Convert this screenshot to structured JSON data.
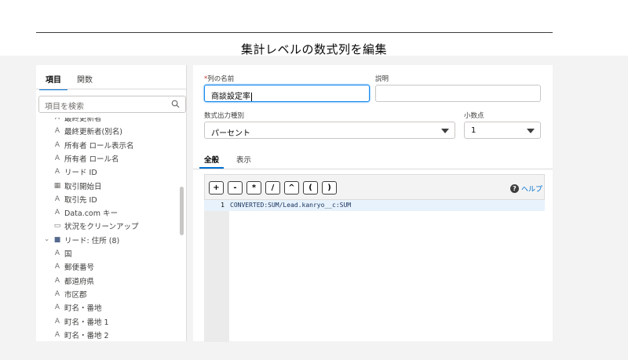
{
  "dialog": {
    "title": "集計レベルの数式列を編集"
  },
  "left_panel": {
    "tabs": [
      {
        "label": "項目"
      },
      {
        "label": "関数"
      }
    ],
    "search_placeholder": "項目を検索",
    "fields": [
      {
        "icon": "text-icon",
        "glyph": "A",
        "label": "最終更新者"
      },
      {
        "icon": "text-icon",
        "glyph": "A",
        "label": "最終更新者(別名)"
      },
      {
        "icon": "text-icon",
        "glyph": "A",
        "label": "所有者 ロール表示名"
      },
      {
        "icon": "text-icon",
        "glyph": "A",
        "label": "所有者 ロール名"
      },
      {
        "icon": "text-icon",
        "glyph": "A",
        "label": "リード ID"
      },
      {
        "icon": "date-icon",
        "glyph": "▦",
        "label": "取引開始日"
      },
      {
        "icon": "text-icon",
        "glyph": "A",
        "label": "取引先 ID"
      },
      {
        "icon": "text-icon",
        "glyph": "A",
        "label": "Data.com キー"
      },
      {
        "icon": "checkbox-icon",
        "glyph": "▭",
        "label": "状況をクリーンアップ"
      },
      {
        "icon": "folder-icon",
        "glyph": "■",
        "label": "リード: 住所 (8)"
      },
      {
        "icon": "text-icon",
        "glyph": "A",
        "label": "国"
      },
      {
        "icon": "text-icon",
        "glyph": "A",
        "label": "郵便番号"
      },
      {
        "icon": "text-icon",
        "glyph": "A",
        "label": "都道府県"
      },
      {
        "icon": "text-icon",
        "glyph": "A",
        "label": "市区郡"
      },
      {
        "icon": "text-icon",
        "glyph": "A",
        "label": "町名・番地"
      },
      {
        "icon": "text-icon",
        "glyph": "A",
        "label": "町名・番地 1"
      },
      {
        "icon": "text-icon",
        "glyph": "A",
        "label": "町名・番地 2"
      }
    ]
  },
  "form": {
    "column_name_label": "列の名前",
    "required_mark": "*",
    "column_name_value": "商談設定率",
    "description_label": "説明",
    "description_value": "",
    "format_label": "数式出力種別",
    "format_value": "パーセント",
    "decimal_label": "小数点",
    "decimal_value": "1"
  },
  "editor": {
    "tabs": [
      {
        "label": "全般"
      },
      {
        "label": "表示"
      }
    ],
    "operators": [
      "+",
      "-",
      "*",
      "/",
      "^",
      "(",
      ")"
    ],
    "help_label": "ヘルプ",
    "lines": [
      {
        "number": "1",
        "code": "CONVERTED:SUM/Lead.kanryo__c:SUM"
      }
    ]
  }
}
